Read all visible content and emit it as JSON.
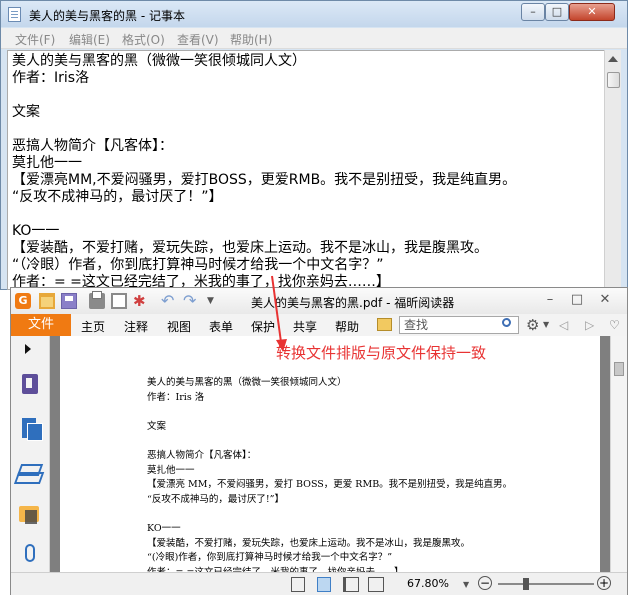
{
  "notepad": {
    "title": "美人的美与黑客的黑 - 记事本",
    "window_buttons": {
      "minimize": "–",
      "maximize": "□",
      "close": "✕"
    },
    "menu": [
      "文件(F)",
      "编辑(E)",
      "格式(O)",
      "查看(V)",
      "帮助(H)"
    ],
    "content": "美人的美与黑客的黑（微微一笑很倾城同人文）\n作者：Iris洛\n\n文案\n\n恶搞人物简介【凡客体】：\n莫扎他一一\n【爱漂亮MM,不爱闷骚男，爱打BOSS，更爱RMB。我不是别扭受，我是纯直男。\n“反攻不成神马的，最讨厌了！”】\n\nKO一一\n【爱装酷，不爱打赌，爱玩失踪，也爱床上运动。我不是冰山，我是腹黑攻。\n“（冷眼）作者，你到底打算神马时候才给我一个中文名字？”\n作者：= =这文已经完结了，米我的事了，找你亲妈去……】"
  },
  "foxit": {
    "title": "美人的美与黑客的黑.pdf - 福昕阅读器",
    "logo_letter": "G",
    "file_tab": "文件",
    "tabs": [
      "主页",
      "注释",
      "视图",
      "表单",
      "保护",
      "共享",
      "帮助"
    ],
    "search_placeholder": "查找",
    "nav": {
      "prev": "◁",
      "next": "▷",
      "collapse": "♡"
    },
    "window_buttons": {
      "minimize": "–",
      "maximize": "□",
      "close": "✕"
    },
    "annotation": "转换文件排版与原文件保持一致",
    "page_content": "美人的美与黑客的黑（微微一笑很倾城同人文）\n作者：Iris 洛\n\n文案\n\n恶搞人物简介【凡客体】：\n莫扎他一一\n【爱漂亮 MM，不爱闷骚男，爱打 BOSS，更爱 RMB。我不是别扭受，我是纯直男。\n“反攻不成神马的，最讨厌了!”】\n\nKO一一\n【爱装酷，不爱打赌，爱玩失踪，也爱床上运动。我不是冰山，我是腹黑攻。\n“(冷眼)作者，你到底打算神马时候才给我一个中文名字？”\n作者：= =这文已经完结了，米我的事了，找你亲妈去……】",
    "zoom": "67.80%",
    "zoom_minus": "−",
    "zoom_plus": "+"
  },
  "colors": {
    "foxit_accent": "#f07a12",
    "annotation_red": "#e83333"
  }
}
